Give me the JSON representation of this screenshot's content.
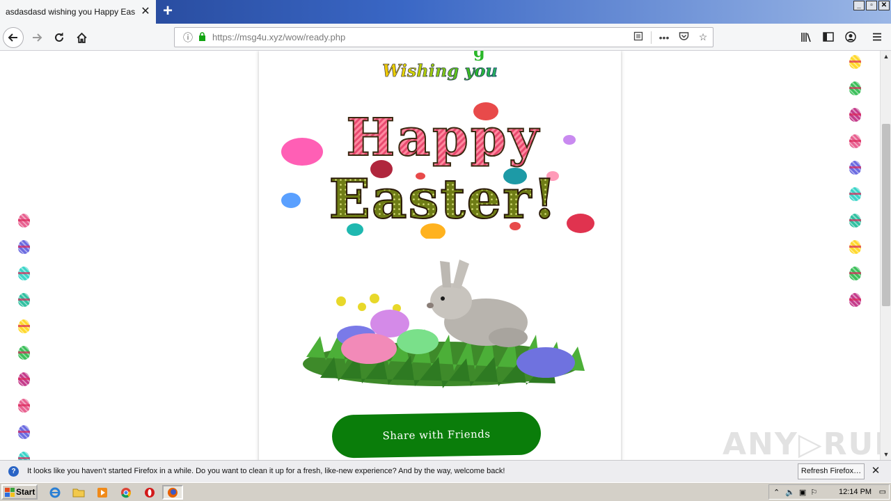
{
  "browser": {
    "tab_title": "asdasdasd wishing you Happy Easter",
    "tab_close": "✕",
    "new_tab": "+",
    "url_host": "https://msg4u.xyz",
    "url_path": "/wow/ready.php",
    "window_controls": [
      "_",
      "▫",
      "✕"
    ]
  },
  "page": {
    "top_fragment": "g",
    "wishing_text": "Wishing you",
    "happy_text": "Happy",
    "easter_text": "Easter!",
    "share_button": "Share with Friends",
    "watermark": "ANY▷RUN"
  },
  "decor": {
    "left_eggs": [
      "#e8608f",
      "#6a6ae0",
      "#3ad4c8",
      "#2fc0a0",
      "#ffd82a",
      "#3bbf5a",
      "#c43a8a",
      "#e8608f",
      "#6a6ae0",
      "#3ad4c8"
    ],
    "right_eggs": [
      "#ffd82a",
      "#3bbf5a",
      "#c43a8a",
      "#e8608f",
      "#6a6ae0",
      "#3ad4c8",
      "#2fc0a0",
      "#ffd82a",
      "#3bbf5a",
      "#c43a8a"
    ]
  },
  "notification": {
    "text": "It looks like you haven’t started Firefox in a while. Do you want to clean it up for a fresh, like-new experience? And by the way, welcome back!",
    "button": "Refresh Firefox…",
    "close": "✕"
  },
  "taskbar": {
    "start_label": "Start",
    "clock": "12:14 PM",
    "apps": [
      "internet-explorer-icon",
      "folder-icon",
      "media-player-icon",
      "chrome-icon",
      "opera-icon",
      "firefox-icon"
    ]
  },
  "colors": {
    "share_button_bg": "#0a7d0a",
    "titlebar_blue": "#2f55b0"
  }
}
